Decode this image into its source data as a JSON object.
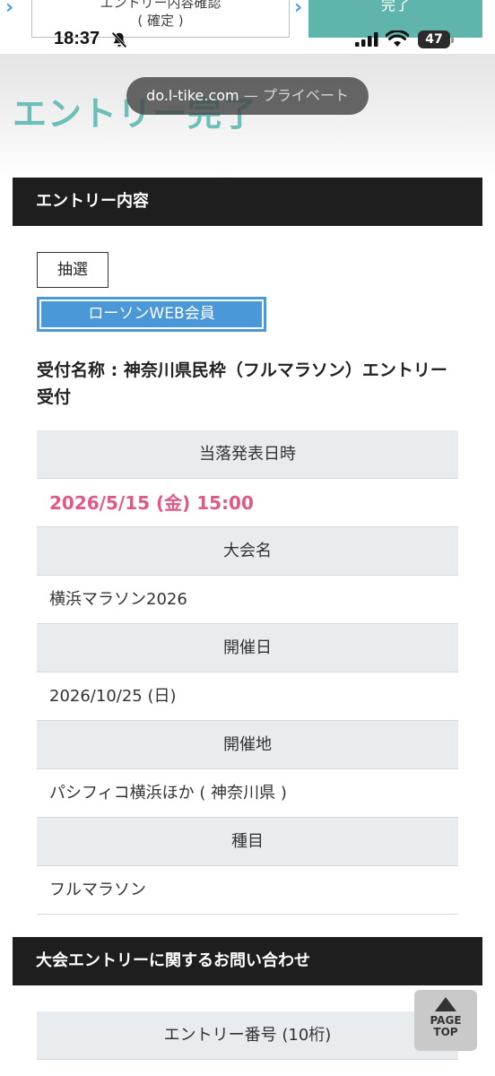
{
  "stepper": {
    "confirm_label_partial": "エントリー内容確認",
    "confirm_sub": "( 確定 )",
    "done_label": "完了"
  },
  "status_bar": {
    "time": "18:37",
    "battery": "47"
  },
  "browser": {
    "domain": "do.l-tike.com",
    "privacy_label": "— プライベート"
  },
  "page": {
    "title": "エントリー完了"
  },
  "entry_section": {
    "header": "エントリー内容",
    "lottery_label": "抽選",
    "member_badge": "ローソンWEB会員",
    "reception_name": "受付名称 : 神奈川県民枠（フルマラソン）エントリー受付"
  },
  "info_table": {
    "announce_header": "当落発表日時",
    "announce_value": "2026/5/15 (金) 15:00",
    "event_header": "大会名",
    "event_value": "横浜マラソン2026",
    "date_header": "開催日",
    "date_value": "2026/10/25 (日)",
    "venue_header": "開催地",
    "venue_value": "パシフィコ横浜ほか ( 神奈川県 )",
    "category_header": "種目",
    "category_value": "フルマラソン"
  },
  "inquiry_section": {
    "header": "大会エントリーに関するお問い合わせ",
    "entry_number_header": "エントリー番号 (10桁)"
  },
  "page_top_button": {
    "line1": "PAGE",
    "line2": "TOP"
  },
  "colors": {
    "accent_teal": "#6bbfb6",
    "member_blue": "#4a98d8",
    "highlight_pink": "#e0588a",
    "section_dark": "#1e1e1e"
  }
}
